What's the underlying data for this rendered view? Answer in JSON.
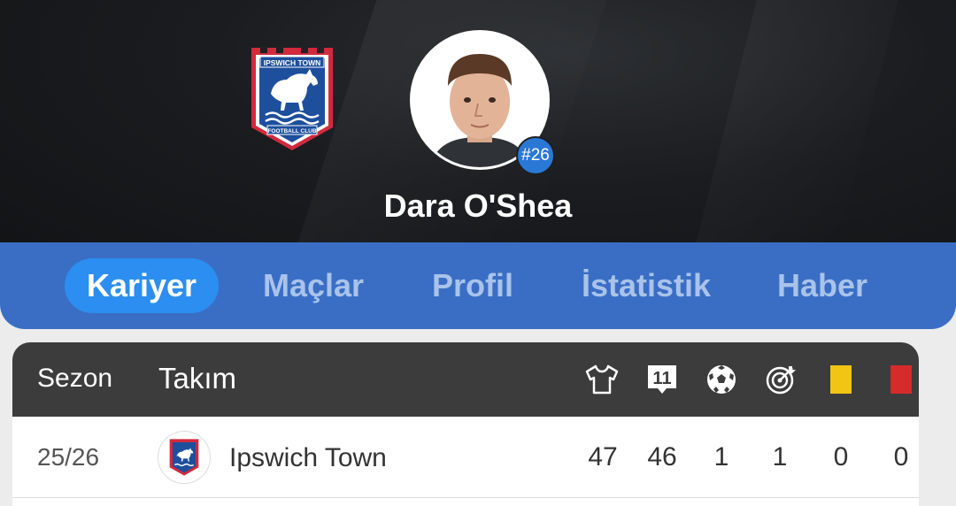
{
  "player": {
    "name": "Dara O'Shea",
    "number": "#26",
    "club_name_top": "IPSWICH TOWN",
    "club_name_bottom": "FOOTBALL CLUB"
  },
  "tabs": [
    {
      "label": "Kariyer",
      "active": true
    },
    {
      "label": "Maçlar",
      "active": false
    },
    {
      "label": "Profil",
      "active": false
    },
    {
      "label": "İstatistik",
      "active": false
    },
    {
      "label": "Haber",
      "active": false
    }
  ],
  "table": {
    "headers": {
      "season": "Sezon",
      "team": "Takım",
      "icons": [
        "shirt-icon",
        "lineup-11-icon",
        "ball-icon",
        "target-icon",
        "yellow-card-icon",
        "red-card-icon"
      ],
      "lineup_label": "11"
    },
    "rows": [
      {
        "season": "25/26",
        "team": "Ipswich Town",
        "apps": "47",
        "starts": "46",
        "goals": "1",
        "assists": "1",
        "yellow": "0",
        "red": "0"
      }
    ]
  },
  "colors": {
    "accent": "#2b8ef0",
    "tab_bar": "#3a6ec5",
    "header_bg": "#3c3c3c",
    "club_blue": "#1d4f9c",
    "club_red": "#d12a3d",
    "yellow_card": "#f2c413",
    "red_card": "#d62b2b"
  }
}
